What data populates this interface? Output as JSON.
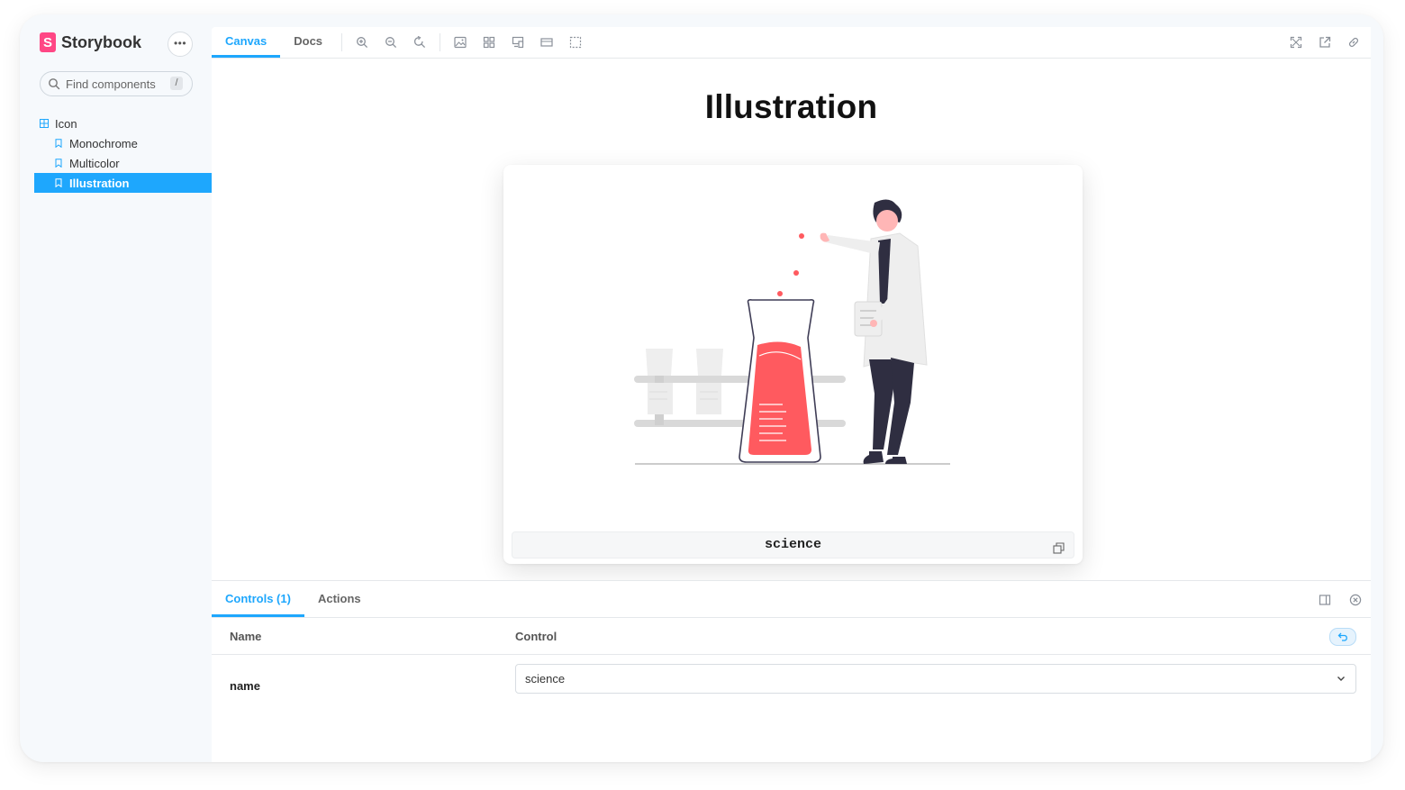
{
  "app": {
    "name": "Storybook",
    "logo_letter": "S"
  },
  "sidebar": {
    "search_placeholder": "Find components",
    "search_shortcut": "/",
    "tree": [
      {
        "label": "Icon",
        "type": "component"
      },
      {
        "label": "Monochrome",
        "type": "story"
      },
      {
        "label": "Multicolor",
        "type": "story"
      },
      {
        "label": "Illustration",
        "type": "story",
        "active": true
      }
    ]
  },
  "toolbar": {
    "tabs": [
      {
        "label": "Canvas",
        "active": true
      },
      {
        "label": "Docs",
        "active": false
      }
    ],
    "tools": [
      "zoom-in-icon",
      "zoom-out-icon",
      "zoom-reset-icon",
      "background-icon",
      "grid-icon",
      "viewport-icon",
      "measure-icon",
      "outline-icon"
    ],
    "right_tools": [
      "fullscreen-icon",
      "open-new-tab-icon",
      "copy-link-icon"
    ]
  },
  "canvas": {
    "title": "Illustration",
    "card_label": "science"
  },
  "panel": {
    "tabs": [
      {
        "label": "Controls (1)",
        "active": true
      },
      {
        "label": "Actions",
        "active": false
      }
    ],
    "table": {
      "headers": {
        "name": "Name",
        "control": "Control"
      },
      "rows": [
        {
          "name": "name",
          "value": "science"
        }
      ]
    }
  },
  "colors": {
    "accent": "#1ea7fd",
    "brand": "#ff4785",
    "illustration_red": "#ff5a5f",
    "illustration_dark": "#2f2e41"
  }
}
